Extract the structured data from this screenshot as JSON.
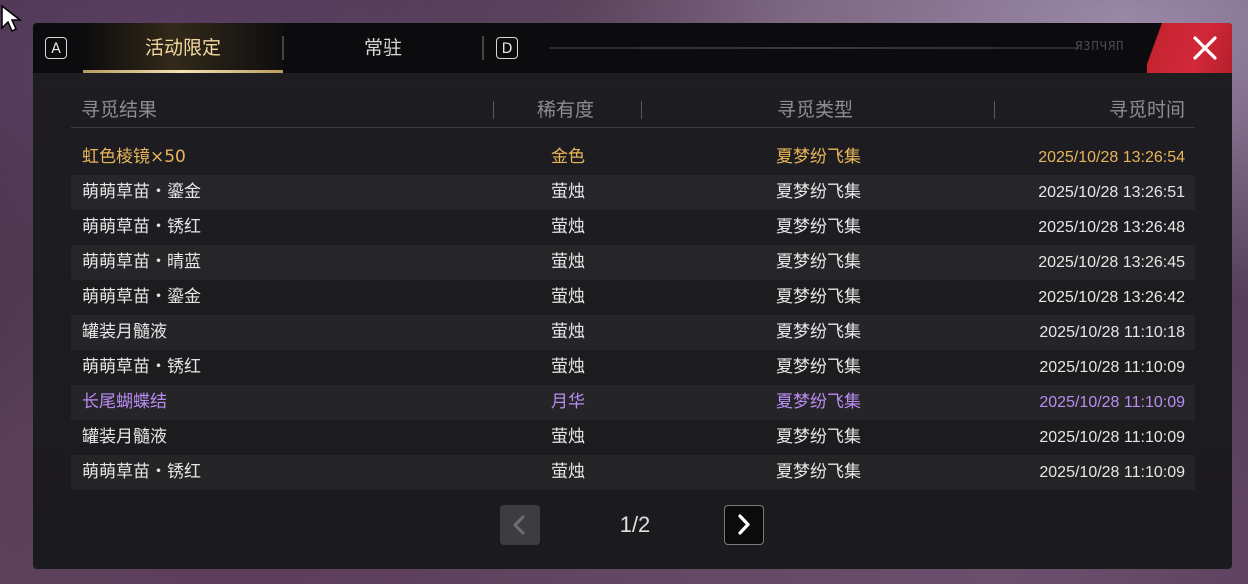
{
  "tabs": {
    "left_key": "A",
    "right_key": "D",
    "items": [
      {
        "label": "活动限定",
        "active": true
      },
      {
        "label": "常驻",
        "active": false
      }
    ],
    "deco_text": "ЯЗПЧЯП"
  },
  "table": {
    "headers": [
      "寻觅结果",
      "稀有度",
      "寻觅类型",
      "寻觅时间"
    ],
    "rows": [
      {
        "name": "虹色棱镜×50",
        "rarity": "金色",
        "type": "夏梦纷飞集",
        "time": "2025/10/28 13:26:54",
        "tier": "gold"
      },
      {
        "name": "萌萌草苗・鎏金",
        "rarity": "萤烛",
        "type": "夏梦纷飞集",
        "time": "2025/10/28 13:26:51",
        "tier": "normal"
      },
      {
        "name": "萌萌草苗・锈红",
        "rarity": "萤烛",
        "type": "夏梦纷飞集",
        "time": "2025/10/28 13:26:48",
        "tier": "normal"
      },
      {
        "name": "萌萌草苗・晴蓝",
        "rarity": "萤烛",
        "type": "夏梦纷飞集",
        "time": "2025/10/28 13:26:45",
        "tier": "normal"
      },
      {
        "name": "萌萌草苗・鎏金",
        "rarity": "萤烛",
        "type": "夏梦纷飞集",
        "time": "2025/10/28 13:26:42",
        "tier": "normal"
      },
      {
        "name": "罐装月髓液",
        "rarity": "萤烛",
        "type": "夏梦纷飞集",
        "time": "2025/10/28 11:10:18",
        "tier": "normal"
      },
      {
        "name": "萌萌草苗・锈红",
        "rarity": "萤烛",
        "type": "夏梦纷飞集",
        "time": "2025/10/28 11:10:09",
        "tier": "normal"
      },
      {
        "name": "长尾蝴蝶结",
        "rarity": "月华",
        "type": "夏梦纷飞集",
        "time": "2025/10/28 11:10:09",
        "tier": "purple"
      },
      {
        "name": "罐装月髓液",
        "rarity": "萤烛",
        "type": "夏梦纷飞集",
        "time": "2025/10/28 11:10:09",
        "tier": "normal"
      },
      {
        "name": "萌萌草苗・锈红",
        "rarity": "萤烛",
        "type": "夏梦纷飞集",
        "time": "2025/10/28 11:10:09",
        "tier": "normal"
      }
    ]
  },
  "pager": {
    "label": "1/2",
    "prev_icon": "chevron-left-icon",
    "next_icon": "chevron-right-icon"
  },
  "colors": {
    "gold": "#e8b55a",
    "purple": "#b98cf4",
    "close_red": "#d2283a"
  },
  "icons": {
    "close": "close-icon",
    "cursor": "cursor-icon"
  }
}
